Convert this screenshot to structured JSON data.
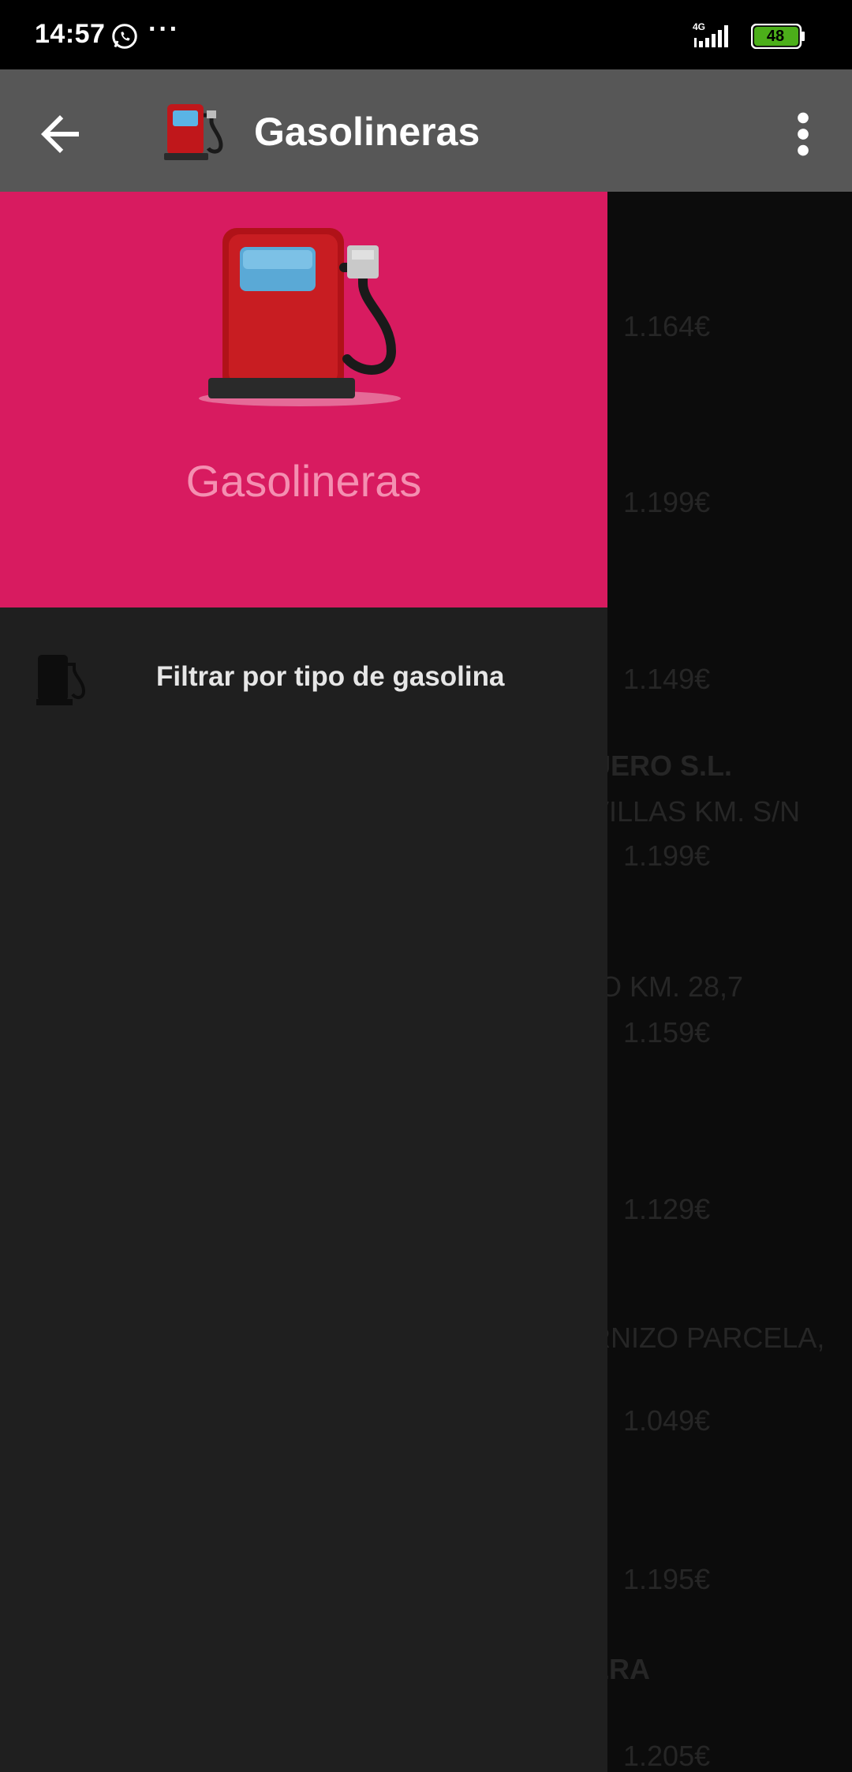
{
  "status_bar": {
    "time": "14:57",
    "more": "···",
    "network": "4G",
    "battery": "48"
  },
  "app_bar": {
    "title": "Gasolineras"
  },
  "drawer": {
    "header_title": "Gasolineras",
    "items": [
      {
        "label": "Filtrar por tipo de gasolina",
        "icon": "fuel-pump-icon"
      }
    ]
  },
  "background_list": {
    "prices": [
      "1.164€",
      "1.199€",
      "1.149€",
      "1.199€",
      "1.159€",
      "1.129€",
      "1.049€",
      "1.195€",
      "1.205€"
    ],
    "fragments": [
      "UERO S.L.",
      "VILLAS KM. S/N",
      "O KM. 28,7",
      "RNIZO PARCELA,",
      "ERA"
    ]
  },
  "colors": {
    "drawer_header": "#d81b60",
    "drawer_title": "#f48fb1",
    "app_bar": "#575757",
    "drawer_body": "#1f1f1f"
  }
}
